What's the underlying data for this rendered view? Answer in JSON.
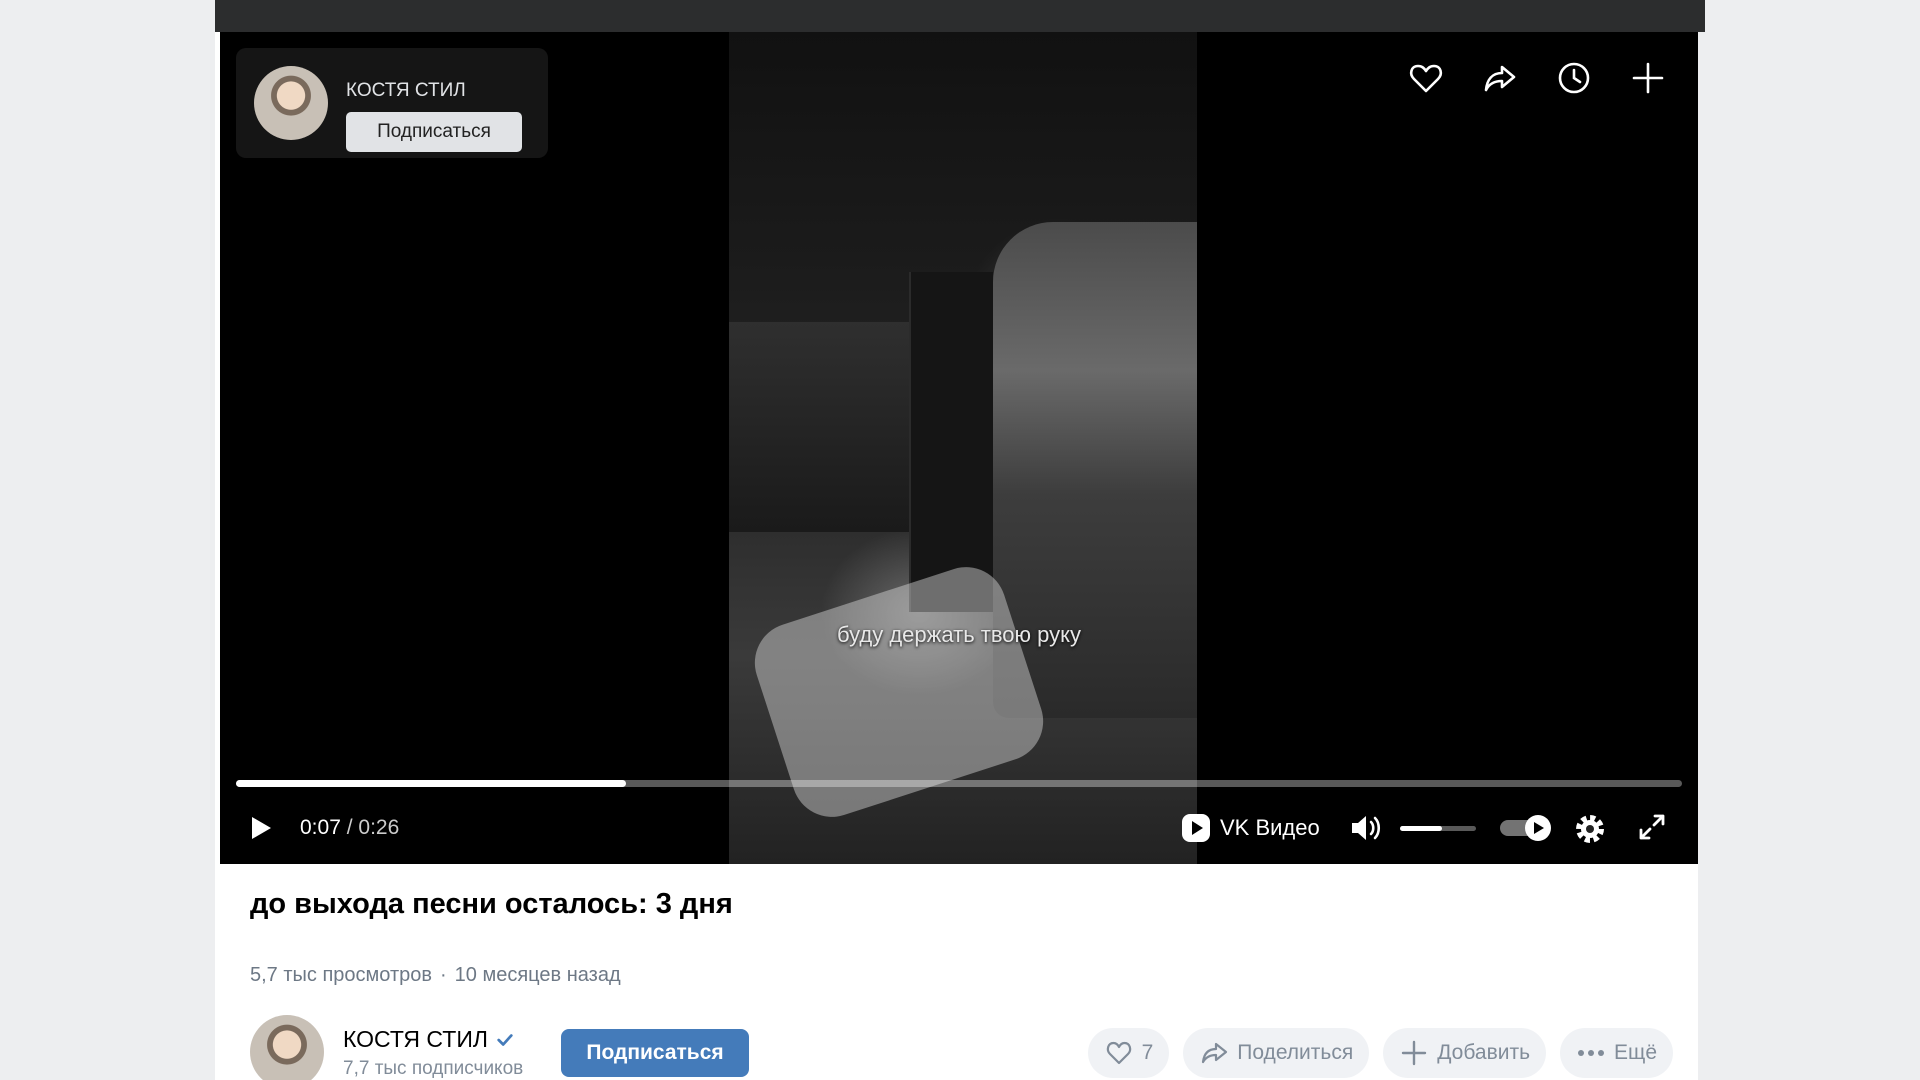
{
  "channel": {
    "name": "КОСТЯ СТИЛ",
    "subscribe_label": "Подписаться",
    "subscribers": "7,7 тыс подписчиков",
    "verified": true
  },
  "player": {
    "subtitle": "буду держать твою руку",
    "time_current": "0:07",
    "time_separator": " / ",
    "time_total": "0:26",
    "progress": 0.27,
    "volume": 0.55,
    "brand": "VK Видео",
    "top_icons": [
      "heart-icon",
      "share-icon",
      "clock-icon",
      "plus-icon"
    ],
    "control_icons": [
      "play-icon",
      "volume-icon",
      "autoplay-toggle",
      "gear-icon",
      "fullscreen-icon"
    ]
  },
  "video": {
    "title": "до выхода песни осталось: 3 дня",
    "views": "5,7 тыс просмотров",
    "separator": "·",
    "age": "10 месяцев назад"
  },
  "actions": {
    "likes": "7",
    "share": "Поделиться",
    "add": "Добавить",
    "more": "Ещё"
  },
  "colors": {
    "accent": "#447bba",
    "player_bg": "#000000",
    "page_bg": "#edeef0"
  }
}
